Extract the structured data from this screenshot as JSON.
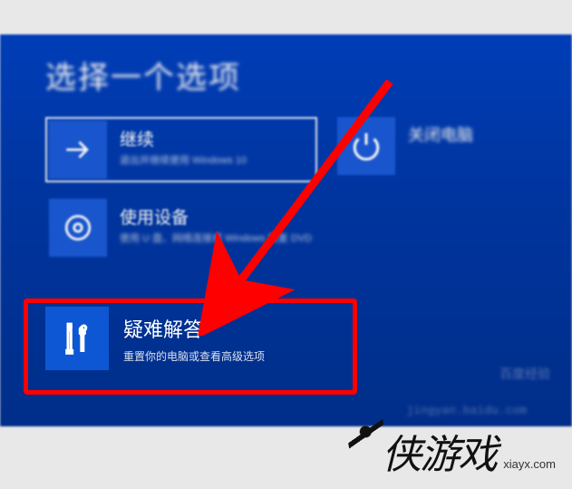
{
  "page_title": "选择一个选项",
  "options": {
    "continue": {
      "label": "继续",
      "desc": "退出并继续使用 Windows 10"
    },
    "use_device": {
      "label": "使用设备",
      "desc": "使用 U 盘、网络连接或 Windows 恢复 DVD"
    },
    "troubleshoot": {
      "label": "疑难解答",
      "desc": "重置你的电脑或查看高级选项"
    },
    "shutdown": {
      "label": "关闭电脑"
    }
  },
  "watermark": {
    "line1": "百度经验",
    "line2": "jingyan.baidu.com"
  },
  "site_logo": {
    "text": "侠游戏",
    "url": "xiayx.com"
  }
}
